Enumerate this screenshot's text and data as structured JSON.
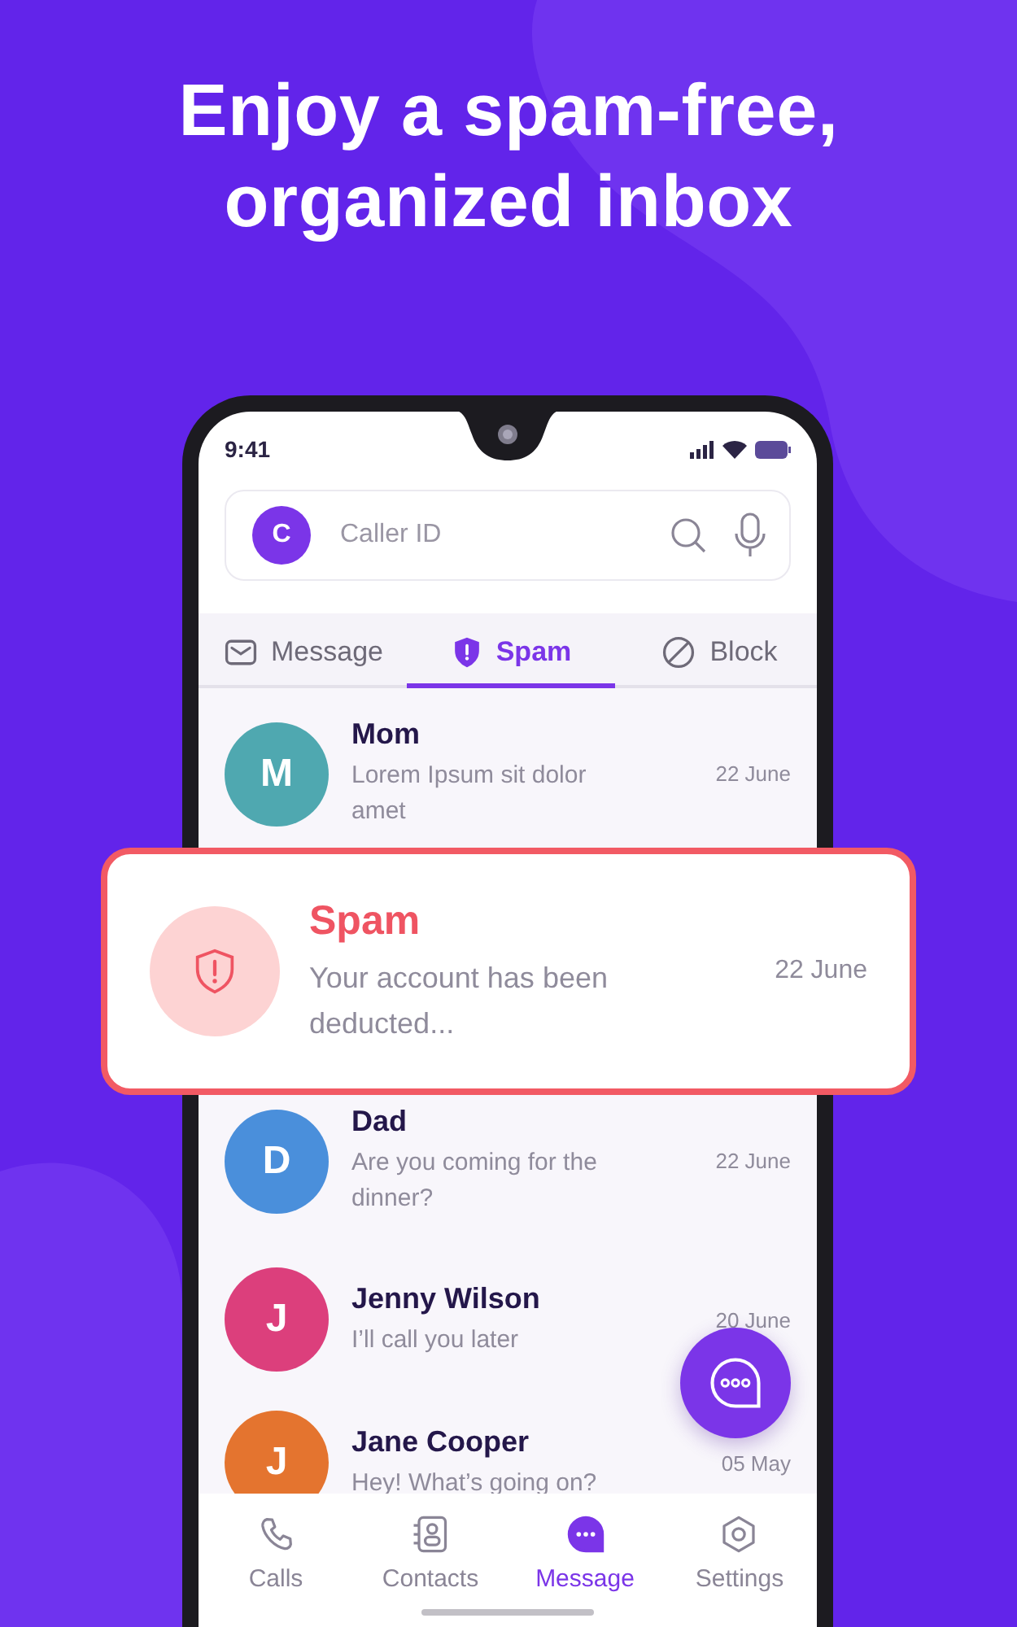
{
  "headline_lines": [
    "Enjoy a spam-free,",
    "organized inbox"
  ],
  "status_bar": {
    "time": "9:41"
  },
  "search": {
    "avatar_letter": "C",
    "placeholder": "Caller ID"
  },
  "tabs": [
    {
      "label": "Message",
      "kind": "envelope",
      "selected": false
    },
    {
      "label": "Spam",
      "kind": "shield",
      "selected": true
    },
    {
      "label": "Block",
      "kind": "block",
      "selected": false
    }
  ],
  "messages": [
    {
      "kind": "contact",
      "name": "Mom",
      "initial": "M",
      "color": "#4fa8b0",
      "preview": "Lorem Ipsum sit dolor amet",
      "date": "22 June"
    },
    {
      "kind": "spam",
      "name": "Spam",
      "preview": "Your account has been deducted...",
      "date": "22 June"
    },
    {
      "kind": "contact",
      "name": "Dad",
      "initial": "D",
      "color": "#4a8fdb",
      "preview": "Are you coming for the dinner?",
      "date": "22 June"
    },
    {
      "kind": "contact",
      "name": "Jenny Wilson",
      "initial": "J",
      "color": "#dc3f7c",
      "preview": "I’ll call you later",
      "date": "20 June"
    },
    {
      "kind": "contact",
      "name": "Jane Cooper",
      "initial": "J",
      "color": "#e4742f",
      "preview": "Hey! What’s going on?",
      "date": "05 May"
    }
  ],
  "bottom_nav": [
    {
      "label": "Calls",
      "kind": "phone",
      "selected": false
    },
    {
      "label": "Contacts",
      "kind": "contacts",
      "selected": false
    },
    {
      "label": "Message",
      "kind": "chat",
      "selected": true
    },
    {
      "label": "Settings",
      "kind": "settings",
      "selected": false
    }
  ]
}
